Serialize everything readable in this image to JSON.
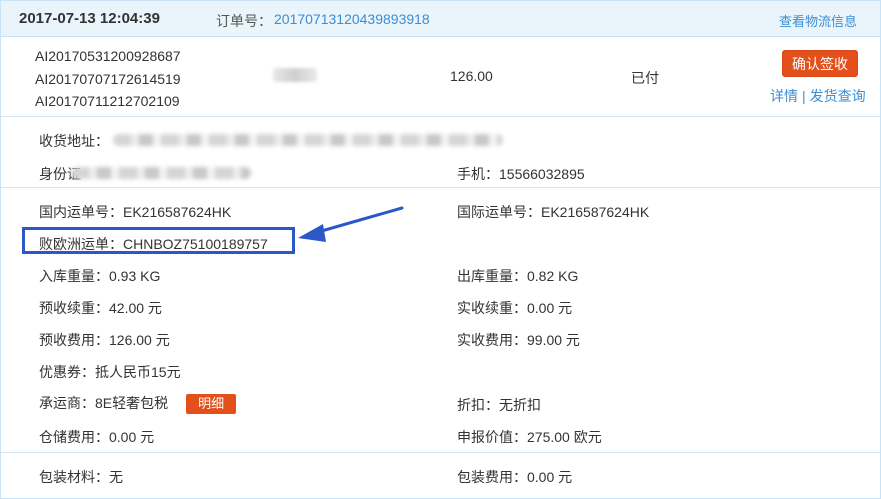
{
  "header": {
    "datetime": "2017-07-13 12:04:39",
    "order_label": "订单号：",
    "order_no": "20170713120439893918",
    "logistics_link": "查看物流信息"
  },
  "item": {
    "tracking_numbers": [
      "AI20170531200928687",
      "AI20170707172614519",
      "AI20170711212702109"
    ],
    "amount": "126.00",
    "status": "已付",
    "confirm_button": "确认签收",
    "detail_link": "详情",
    "separator": "|",
    "shipping_query_link": "发货查询"
  },
  "address": {
    "label": "收货地址：",
    "id_label": "身份证",
    "phone_label": "手机：",
    "phone": "15566032895"
  },
  "shipping": {
    "domestic_label": "国内运单号：",
    "domestic_no": "EK216587624HK",
    "intl_label": "国际运单号：",
    "intl_no": "EK216587624HK",
    "eu_label": "败欧洲运单：",
    "eu_no": "CHNBOZ75100189757"
  },
  "fees": {
    "in_weight_label": "入库重量：",
    "in_weight": "0.93 KG",
    "out_weight_label": "出库重量：",
    "out_weight": "0.82 KG",
    "pre_renew_label": "预收续重：",
    "pre_renew": "42.00 元",
    "actual_renew_label": "实收续重：",
    "actual_renew": "0.00 元",
    "pre_fee_label": "预收费用：",
    "pre_fee": "126.00 元",
    "actual_fee_label": "实收费用：",
    "actual_fee": "99.00 元",
    "coupon_label": "优惠券：",
    "coupon": "抵人民币15元",
    "carrier_label": "承运商：",
    "carrier": "8E轻奢包税",
    "carrier_detail_button": "明细",
    "discount_label": "折扣：",
    "discount": "无折扣",
    "storage_label": "仓储费用：",
    "storage": "0.00 元",
    "declared_label": "申报价值：",
    "declared": "275.00 欧元",
    "packing_material_label": "包装材料：",
    "packing_material": "无",
    "packing_fee_label": "包装费用：",
    "packing_fee": "0.00 元"
  },
  "colors": {
    "accent_blue": "#3b8ed4",
    "button_orange": "#e4501c",
    "highlight_box": "#2b57c9",
    "header_bg": "#e9f4fb"
  }
}
